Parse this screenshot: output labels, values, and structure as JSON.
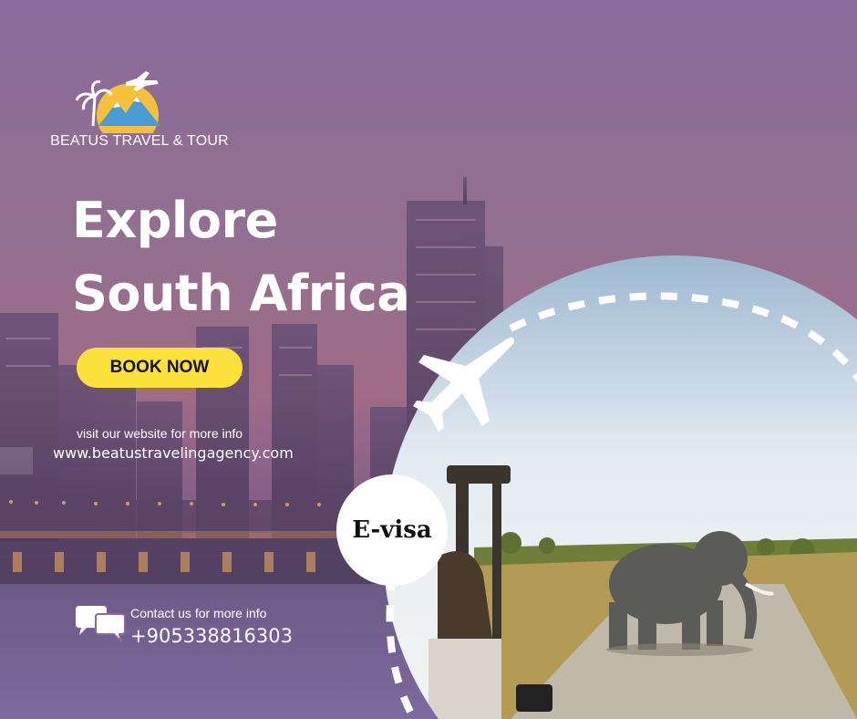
{
  "brand": {
    "name": "BEATUS TRAVEL & TOUR",
    "logo_icon": "palm-mountain-plane-logo"
  },
  "headline": {
    "line1": "Explore",
    "line2": "South Africa"
  },
  "cta": {
    "book_label": "BOOK NOW",
    "color": "#fbe13a"
  },
  "website": {
    "note": "visit our website for more info",
    "url": "www.beatustravelingagency.com"
  },
  "contact": {
    "note": "Contact us for more info",
    "phone": "+905338816303",
    "icon": "chat-bubbles-icon"
  },
  "badge": {
    "label": "E-visa"
  },
  "colors": {
    "background_purple": "#8a6a9a",
    "accent_yellow": "#fbe13a",
    "text": "#ffffff"
  }
}
